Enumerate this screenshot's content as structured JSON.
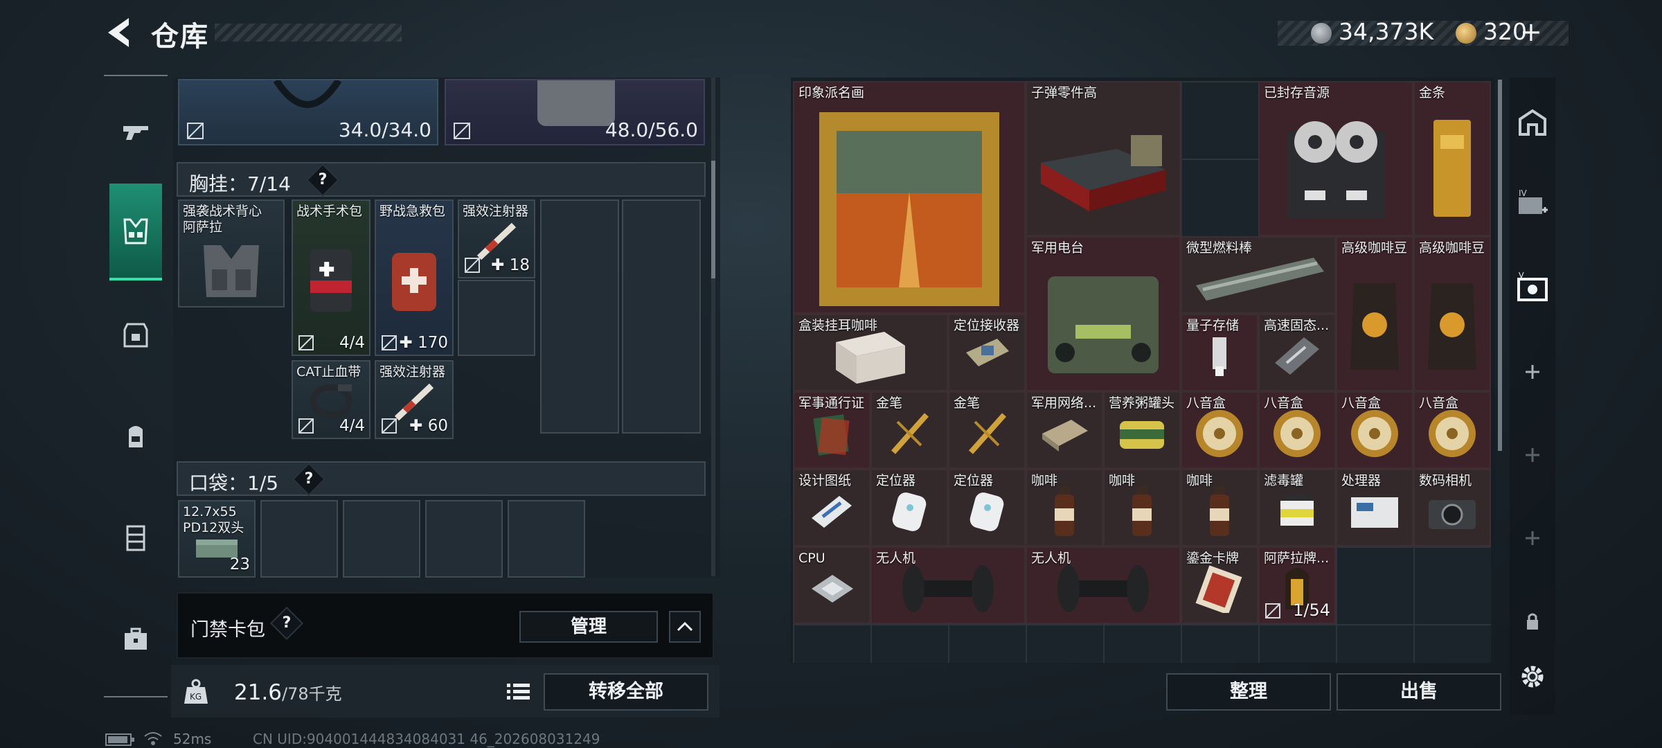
{
  "header": {
    "title": "仓库",
    "silver": "34,373K",
    "gold": "320",
    "plus": "+"
  },
  "colors": {
    "accent_green": "#35e0a9",
    "rare_red": "#3c2329"
  },
  "top_slots": [
    {
      "value": "34.0/34.0"
    },
    {
      "value": "48.0/56.0"
    }
  ],
  "chest_rig": {
    "label": "胸挂：7/14",
    "help": "?",
    "items": [
      {
        "name": "强袭战术背心\n阿萨拉",
        "count": ""
      },
      {
        "name": "战术手术包",
        "count": "4/4"
      },
      {
        "name": "野战急救包",
        "count": "170"
      },
      {
        "name": "强效注射器",
        "count": "18"
      },
      {
        "name": "CAT止血带",
        "count": "4/4"
      },
      {
        "name": "强效注射器",
        "count": "60"
      }
    ]
  },
  "pocket": {
    "label": "口袋：1/5",
    "help": "?",
    "items": [
      {
        "name": "12.7x55\nPD12双头",
        "count": "23"
      }
    ]
  },
  "key_card": {
    "label": "门禁卡包",
    "help": "?",
    "manage": "管理"
  },
  "weight": {
    "current": "21.6",
    "max": "/78千克"
  },
  "transfer_all": "转移全部",
  "stash": {
    "items": [
      {
        "name": "印象派名画"
      },
      {
        "name": "子弹零件高"
      },
      {
        "name": "已封存音源"
      },
      {
        "name": "金条"
      },
      {
        "name": "军用电台"
      },
      {
        "name": "微型燃料棒"
      },
      {
        "name": "高级咖啡豆"
      },
      {
        "name": "高级咖啡豆"
      },
      {
        "name": "盒装挂耳咖啡"
      },
      {
        "name": "定位接收器"
      },
      {
        "name": "量子存储"
      },
      {
        "name": "高速固态..."
      },
      {
        "name": "军事通行证"
      },
      {
        "name": "金笔"
      },
      {
        "name": "金笔"
      },
      {
        "name": "军用网络..."
      },
      {
        "name": "营养粥罐头"
      },
      {
        "name": "八音盒"
      },
      {
        "name": "八音盒"
      },
      {
        "name": "八音盒"
      },
      {
        "name": "八音盒"
      },
      {
        "name": "设计图纸"
      },
      {
        "name": "定位器"
      },
      {
        "name": "定位器"
      },
      {
        "name": "咖啡"
      },
      {
        "name": "咖啡"
      },
      {
        "name": "咖啡"
      },
      {
        "name": "滤毒罐"
      },
      {
        "name": "处理器"
      },
      {
        "name": "数码相机"
      },
      {
        "name": "CPU"
      },
      {
        "name": "无人机"
      },
      {
        "name": "无人机"
      },
      {
        "name": "鎏金卡牌"
      },
      {
        "name": "阿萨拉牌...",
        "count": "1/54"
      }
    ],
    "sort": "整理",
    "sell": "出售"
  },
  "footer": {
    "ping": "52ms",
    "uid": "CN UID:904001444834084031 46_202608031249"
  }
}
